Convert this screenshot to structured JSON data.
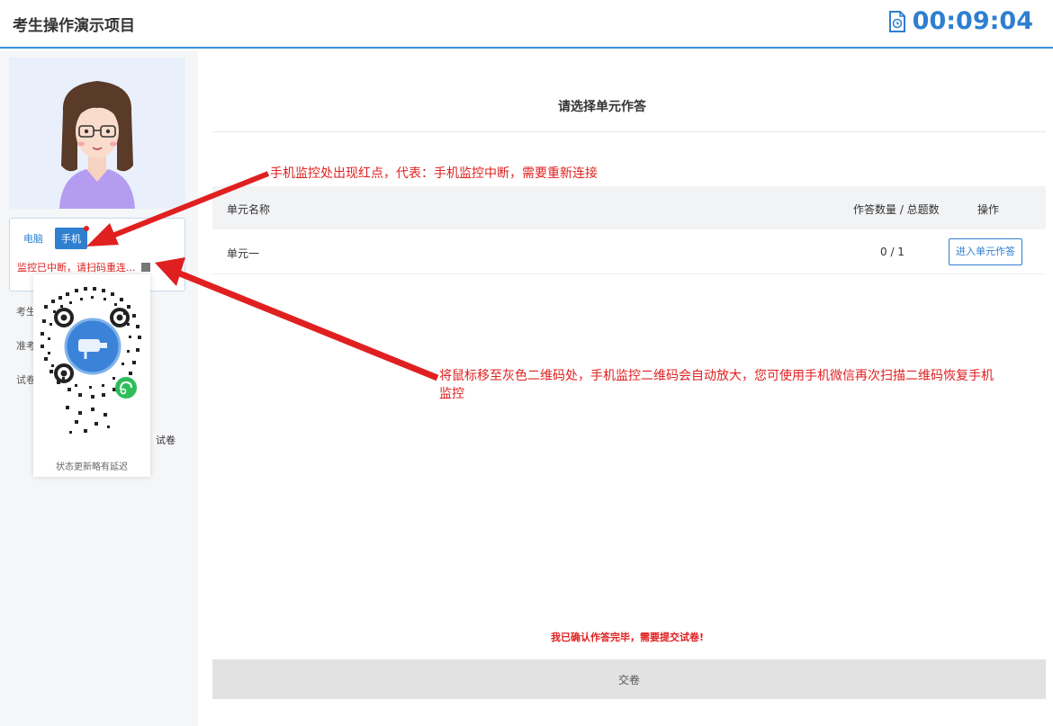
{
  "header": {
    "title": "考生操作演示项目",
    "timer": "00:09:04",
    "icon": "file-timer-icon"
  },
  "sidebar": {
    "monitor": {
      "tab_computer": "电脑",
      "tab_phone": "手机",
      "status": "监控已中断，请扫码重连..."
    },
    "info_labels": [
      "考生",
      "准考",
      "试卷"
    ],
    "exam_label": "试卷",
    "qr_caption": "状态更新略有延迟"
  },
  "main": {
    "title": "请选择单元作答",
    "table": {
      "headers": [
        "单元名称",
        "作答数量 / 总题数",
        "操作"
      ],
      "rows": [
        {
          "name": "单元一",
          "progress": "0 / 1",
          "action": "进入单元作答"
        }
      ]
    },
    "confirm_text": "我已确认作答完毕，需要提交试卷!",
    "submit_label": "交卷"
  },
  "annotations": {
    "note1": "手机监控处出现红点，代表：手机监控中断，需要重新连接",
    "note2": "将鼠标移至灰色二维码处，手机监控二维码会自动放大，您可使用手机微信再次扫描二维码恢复手机监控"
  },
  "colors": {
    "accent": "#2e7fd0",
    "alert": "#e02020",
    "submit_bg": "#e2e2e2"
  }
}
